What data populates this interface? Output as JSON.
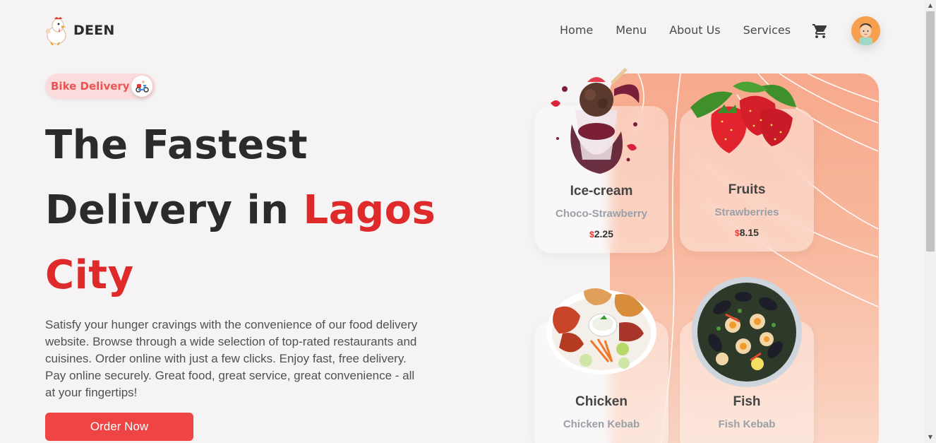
{
  "brand": {
    "name": "DEEN",
    "logo_icon": "chicken-mascot-icon"
  },
  "nav": {
    "items": [
      "Home",
      "Menu",
      "About Us",
      "Services"
    ],
    "cart_icon": "cart-icon",
    "avatar_icon": "user-avatar-icon"
  },
  "hero": {
    "badge_label": "Bike Delivery",
    "badge_icon": "scooter-icon",
    "title_line1": "The Fastest",
    "title_line2_prefix": "Delivery in ",
    "title_highlight_1": "Lagos",
    "title_highlight_2": "City",
    "description": "Satisfy your hunger cravings with the convenience of our food delivery website. Browse through a wide selection of top-rated restaurants and cuisines. Order online with just a few clicks. Enjoy fast, free delivery. Pay online securely. Great food, great service, great convenience - all at your fingertips!",
    "cta_label": "Order Now"
  },
  "cards": [
    {
      "title": "Ice-cream",
      "subtitle": "Choco-Strawberry",
      "currency": "$",
      "price": "2.25"
    },
    {
      "title": "Fruits",
      "subtitle": "Strawberries",
      "currency": "$",
      "price": "8.15"
    },
    {
      "title": "Chicken",
      "subtitle": "Chicken Kebab"
    },
    {
      "title": "Fish",
      "subtitle": "Fish Kebab"
    }
  ],
  "colors": {
    "accent": "#de2a2a",
    "button": "#ef4444",
    "badge_bg": "#fbdcdc",
    "panel_peach": "#f7a98d"
  }
}
